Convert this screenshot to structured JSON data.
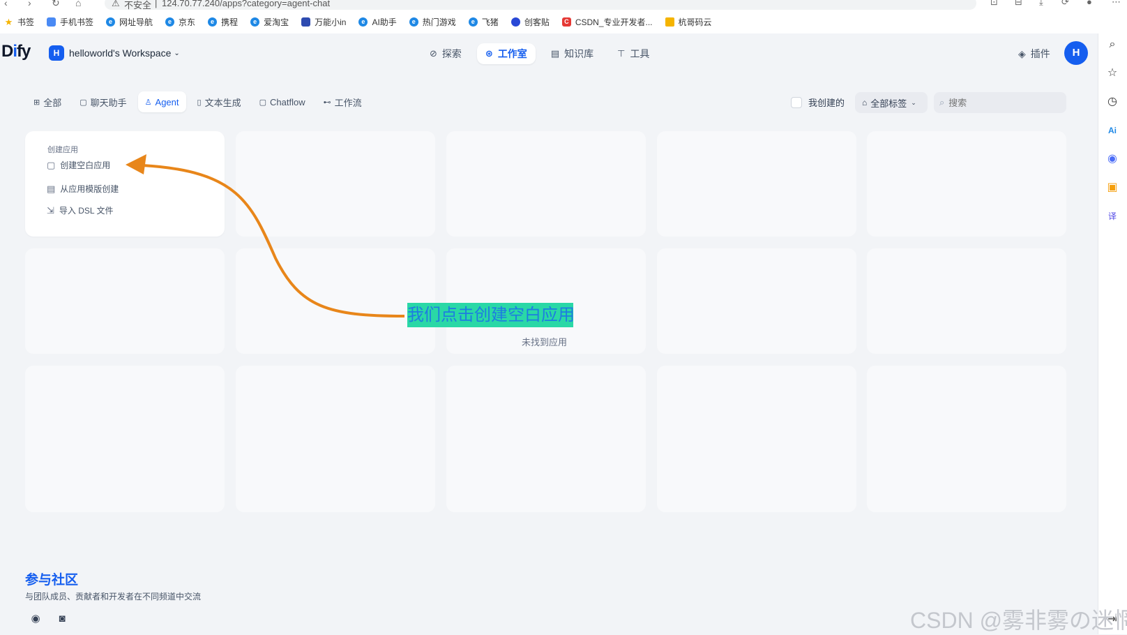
{
  "browser": {
    "url_prefix": "不安全",
    "url": "124.70.77.240/apps?category=agent-chat",
    "bookmarks": [
      {
        "label": "书签",
        "icon": "star-icon",
        "color": "#f5b400"
      },
      {
        "label": "手机书签",
        "icon": "phone-icon",
        "color": "#4a8af4"
      },
      {
        "label": "网址导航",
        "icon": "e-browser-icon",
        "color": "#1e88e5"
      },
      {
        "label": "京东",
        "icon": "e-browser-icon",
        "color": "#1e88e5"
      },
      {
        "label": "携程",
        "icon": "e-browser-icon",
        "color": "#1e88e5"
      },
      {
        "label": "爱淘宝",
        "icon": "e-browser-icon",
        "color": "#1e88e5"
      },
      {
        "label": "万能小in",
        "icon": "robot-icon",
        "color": "#2e4bb0"
      },
      {
        "label": "AI助手",
        "icon": "e-browser-icon",
        "color": "#1e88e5"
      },
      {
        "label": "热门游戏",
        "icon": "e-browser-icon",
        "color": "#1e88e5"
      },
      {
        "label": "飞猪",
        "icon": "e-browser-icon",
        "color": "#1e88e5"
      },
      {
        "label": "创客贴",
        "icon": "shield-icon",
        "color": "#2948d6"
      },
      {
        "label": "CSDN_专业开发者...",
        "icon": "csdn-icon",
        "color": "#e53935"
      },
      {
        "label": "杭哥码云",
        "icon": "folder-icon",
        "color": "#f5b400"
      }
    ]
  },
  "header": {
    "logo_prefix": "D",
    "logo_mid": "i",
    "logo_suffix": "fy",
    "workspace_initial": "H",
    "workspace_name": "helloworld's Workspace",
    "nav": [
      {
        "label": "探索",
        "icon": "compass-icon",
        "active": false
      },
      {
        "label": "工作室",
        "icon": "robot-icon",
        "active": true
      },
      {
        "label": "知识库",
        "icon": "book-icon",
        "active": false
      },
      {
        "label": "工具",
        "icon": "hammer-icon",
        "active": false
      }
    ],
    "plugin_label": "插件",
    "user_initial": "H"
  },
  "filters": {
    "tabs": [
      {
        "label": "全部",
        "icon": "grid-icon",
        "active": false
      },
      {
        "label": "聊天助手",
        "icon": "chat-icon",
        "active": false
      },
      {
        "label": "Agent",
        "icon": "agent-icon",
        "active": true
      },
      {
        "label": "文本生成",
        "icon": "doc-icon",
        "active": false
      },
      {
        "label": "Chatflow",
        "icon": "chat-icon",
        "active": false
      },
      {
        "label": "工作流",
        "icon": "flow-icon",
        "active": false
      }
    ],
    "mine_label": "我创建的",
    "tag_label": "全部标签",
    "search_placeholder": "搜索"
  },
  "create_card": {
    "title": "创建应用",
    "options": [
      "创建空白应用",
      "从应用模版创建",
      "导入 DSL 文件"
    ]
  },
  "empty_text": "未找到应用",
  "annotation": "我们点击创建空白应用",
  "community": {
    "title": "参与社区",
    "subtitle": "与团队成员、贡献者和开发者在不同频道中交流"
  },
  "watermark": "CSDN @雾非雾の迷惘",
  "colors": {
    "accent": "#155eef",
    "annotation_bg": "#2ad8a6",
    "arrow": "#e8861a"
  }
}
